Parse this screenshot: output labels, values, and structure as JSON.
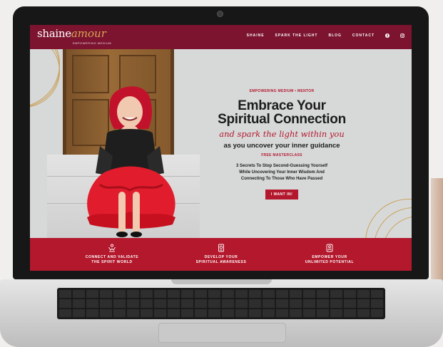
{
  "site": {
    "logo": {
      "name": "shaine",
      "script": "amour",
      "tagline": "EMPOWERING MEDIUM"
    },
    "nav": {
      "items": [
        {
          "label": "SHAINE"
        },
        {
          "label": "SPARK THE LIGHT"
        },
        {
          "label": "BLOG"
        },
        {
          "label": "CONTACT"
        }
      ],
      "social_icons": [
        "facebook-icon",
        "instagram-icon"
      ]
    },
    "hero": {
      "eyebrow": "EMPOWERING MEDIUM • MENTOR",
      "headline_line1": "Embrace Your",
      "headline_line2": "Spiritual Connection",
      "script_line": "and spark the light within you",
      "subhead": "as you uncover your inner guidance",
      "free_label": "FREE MASTERCLASS",
      "description": {
        "line1": "3 Secrets To Stop Second-Guessing Yourself",
        "line2": "While Uncovering Your Inner Wisdom And",
        "line3": "Connecting To Those Who Have Passed"
      },
      "cta_label": "I WANT IN!"
    },
    "features": [
      {
        "icon": "spirit-hands-icon",
        "line1": "CONNECT AND VALIDATE",
        "line2": "THE SPIRIT WORLD"
      },
      {
        "icon": "awareness-icon",
        "line1": "DEVELOP YOUR",
        "line2": "SPIRITUAL AWARENESS"
      },
      {
        "icon": "empower-icon",
        "line1": "EMPOWER YOUR",
        "line2": "UNLIMITED POTENTIAL"
      }
    ]
  },
  "colors": {
    "header": "#7c1430",
    "accent_red": "#b3182c",
    "gold": "#c9a25d",
    "hero_bg": "#d7d9d9"
  }
}
